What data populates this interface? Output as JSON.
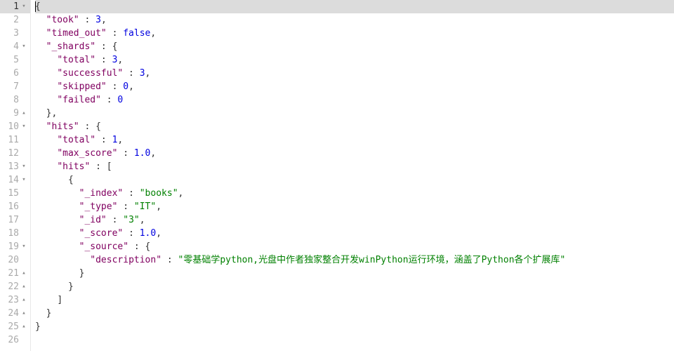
{
  "active_line": 1,
  "total_lines": 26,
  "lines": [
    {
      "n": 1,
      "fold": "▾",
      "indent": 0,
      "tokens": [
        {
          "t": "punct",
          "v": "{"
        }
      ],
      "cursor_before": true
    },
    {
      "n": 2,
      "fold": "",
      "indent": 1,
      "tokens": [
        {
          "t": "key",
          "v": "\"took\""
        },
        {
          "t": "punct",
          "v": " : "
        },
        {
          "t": "number",
          "v": "3"
        },
        {
          "t": "punct",
          "v": ","
        }
      ]
    },
    {
      "n": 3,
      "fold": "",
      "indent": 1,
      "tokens": [
        {
          "t": "key",
          "v": "\"timed_out\""
        },
        {
          "t": "punct",
          "v": " : "
        },
        {
          "t": "bool",
          "v": "false"
        },
        {
          "t": "punct",
          "v": ","
        }
      ]
    },
    {
      "n": 4,
      "fold": "▾",
      "indent": 1,
      "tokens": [
        {
          "t": "key",
          "v": "\"_shards\""
        },
        {
          "t": "punct",
          "v": " : {"
        }
      ]
    },
    {
      "n": 5,
      "fold": "",
      "indent": 2,
      "tokens": [
        {
          "t": "key",
          "v": "\"total\""
        },
        {
          "t": "punct",
          "v": " : "
        },
        {
          "t": "number",
          "v": "3"
        },
        {
          "t": "punct",
          "v": ","
        }
      ]
    },
    {
      "n": 6,
      "fold": "",
      "indent": 2,
      "tokens": [
        {
          "t": "key",
          "v": "\"successful\""
        },
        {
          "t": "punct",
          "v": " : "
        },
        {
          "t": "number",
          "v": "3"
        },
        {
          "t": "punct",
          "v": ","
        }
      ]
    },
    {
      "n": 7,
      "fold": "",
      "indent": 2,
      "tokens": [
        {
          "t": "key",
          "v": "\"skipped\""
        },
        {
          "t": "punct",
          "v": " : "
        },
        {
          "t": "number",
          "v": "0"
        },
        {
          "t": "punct",
          "v": ","
        }
      ]
    },
    {
      "n": 8,
      "fold": "",
      "indent": 2,
      "tokens": [
        {
          "t": "key",
          "v": "\"failed\""
        },
        {
          "t": "punct",
          "v": " : "
        },
        {
          "t": "number",
          "v": "0"
        }
      ]
    },
    {
      "n": 9,
      "fold": "▴",
      "indent": 1,
      "tokens": [
        {
          "t": "punct",
          "v": "},"
        }
      ]
    },
    {
      "n": 10,
      "fold": "▾",
      "indent": 1,
      "tokens": [
        {
          "t": "key",
          "v": "\"hits\""
        },
        {
          "t": "punct",
          "v": " : {"
        }
      ]
    },
    {
      "n": 11,
      "fold": "",
      "indent": 2,
      "tokens": [
        {
          "t": "key",
          "v": "\"total\""
        },
        {
          "t": "punct",
          "v": " : "
        },
        {
          "t": "number",
          "v": "1"
        },
        {
          "t": "punct",
          "v": ","
        }
      ]
    },
    {
      "n": 12,
      "fold": "",
      "indent": 2,
      "tokens": [
        {
          "t": "key",
          "v": "\"max_score\""
        },
        {
          "t": "punct",
          "v": " : "
        },
        {
          "t": "number",
          "v": "1.0"
        },
        {
          "t": "punct",
          "v": ","
        }
      ]
    },
    {
      "n": 13,
      "fold": "▾",
      "indent": 2,
      "tokens": [
        {
          "t": "key",
          "v": "\"hits\""
        },
        {
          "t": "punct",
          "v": " : ["
        }
      ]
    },
    {
      "n": 14,
      "fold": "▾",
      "indent": 3,
      "tokens": [
        {
          "t": "punct",
          "v": "{"
        }
      ]
    },
    {
      "n": 15,
      "fold": "",
      "indent": 4,
      "tokens": [
        {
          "t": "key",
          "v": "\"_index\""
        },
        {
          "t": "punct",
          "v": " : "
        },
        {
          "t": "string",
          "v": "\"books\""
        },
        {
          "t": "punct",
          "v": ","
        }
      ]
    },
    {
      "n": 16,
      "fold": "",
      "indent": 4,
      "tokens": [
        {
          "t": "key",
          "v": "\"_type\""
        },
        {
          "t": "punct",
          "v": " : "
        },
        {
          "t": "string",
          "v": "\"IT\""
        },
        {
          "t": "punct",
          "v": ","
        }
      ]
    },
    {
      "n": 17,
      "fold": "",
      "indent": 4,
      "tokens": [
        {
          "t": "key",
          "v": "\"_id\""
        },
        {
          "t": "punct",
          "v": " : "
        },
        {
          "t": "string",
          "v": "\"3\""
        },
        {
          "t": "punct",
          "v": ","
        }
      ]
    },
    {
      "n": 18,
      "fold": "",
      "indent": 4,
      "tokens": [
        {
          "t": "key",
          "v": "\"_score\""
        },
        {
          "t": "punct",
          "v": " : "
        },
        {
          "t": "number",
          "v": "1.0"
        },
        {
          "t": "punct",
          "v": ","
        }
      ]
    },
    {
      "n": 19,
      "fold": "▾",
      "indent": 4,
      "tokens": [
        {
          "t": "key",
          "v": "\"_source\""
        },
        {
          "t": "punct",
          "v": " : {"
        }
      ]
    },
    {
      "n": 20,
      "fold": "",
      "indent": 5,
      "tokens": [
        {
          "t": "key",
          "v": "\"description\""
        },
        {
          "t": "punct",
          "v": " : "
        },
        {
          "t": "string",
          "v": "\"零基础学python,光盘中作者独家整合开发winPython运行环境，涵盖了Python各个扩展库\""
        }
      ]
    },
    {
      "n": 21,
      "fold": "▴",
      "indent": 4,
      "tokens": [
        {
          "t": "punct",
          "v": "}"
        }
      ]
    },
    {
      "n": 22,
      "fold": "▴",
      "indent": 3,
      "tokens": [
        {
          "t": "punct",
          "v": "}"
        }
      ]
    },
    {
      "n": 23,
      "fold": "▴",
      "indent": 2,
      "tokens": [
        {
          "t": "punct",
          "v": "]"
        }
      ]
    },
    {
      "n": 24,
      "fold": "▴",
      "indent": 1,
      "tokens": [
        {
          "t": "punct",
          "v": "}"
        }
      ]
    },
    {
      "n": 25,
      "fold": "▴",
      "indent": 0,
      "tokens": [
        {
          "t": "punct",
          "v": "}"
        }
      ]
    },
    {
      "n": 26,
      "fold": "",
      "indent": 0,
      "tokens": []
    }
  ]
}
